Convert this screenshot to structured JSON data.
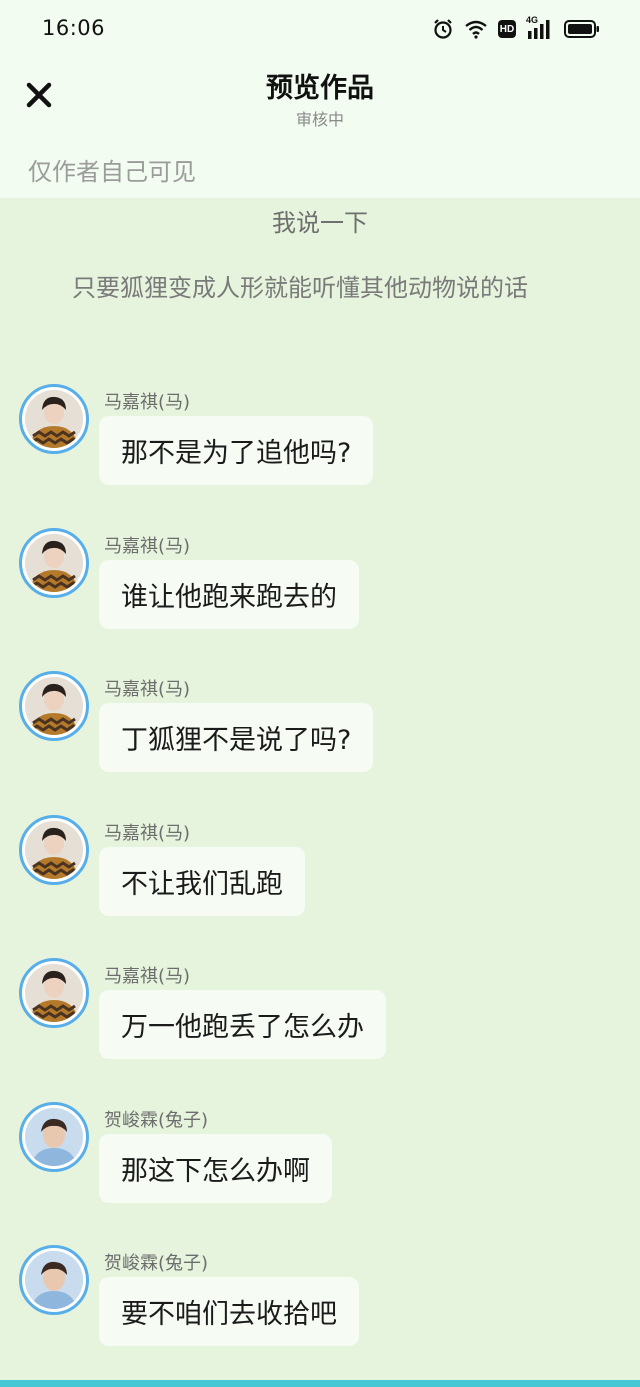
{
  "status_bar": {
    "time": "16:06",
    "icons": [
      "alarm-icon",
      "wifi-icon",
      "hd-icon",
      "signal-4g-icon",
      "battery-icon"
    ],
    "hd_label": "HD",
    "network_label": "4G"
  },
  "header": {
    "close_icon": "close-icon",
    "title": "预览作品",
    "subtitle": "审核中"
  },
  "visibility_note": "仅作者自己可见",
  "story": {
    "title": "我说一下",
    "narration": "只要狐狸变成人形就能听懂其他动物说的话"
  },
  "messages": [
    {
      "sender": "马嘉祺(马)",
      "avatar": "ma",
      "text": "那不是为了追他吗?"
    },
    {
      "sender": "马嘉祺(马)",
      "avatar": "ma",
      "text": "谁让他跑来跑去的"
    },
    {
      "sender": "马嘉祺(马)",
      "avatar": "ma",
      "text": "丁狐狸不是说了吗?"
    },
    {
      "sender": "马嘉祺(马)",
      "avatar": "ma",
      "text": "不让我们乱跑"
    },
    {
      "sender": "马嘉祺(马)",
      "avatar": "ma",
      "text": "万一他跑丢了怎么办"
    },
    {
      "sender": "贺峻霖(兔子)",
      "avatar": "he",
      "text": "那这下怎么办啊"
    },
    {
      "sender": "贺峻霖(兔子)",
      "avatar": "he",
      "text": "要不咱们去收拾吧"
    }
  ],
  "colors": {
    "page_bg": "#e6f4dd",
    "header_bg": "#f3fcf1",
    "bubble_bg": "#f6fcf4",
    "avatar_ring": "#58aee8",
    "bottom_bar": "#46c7d4"
  }
}
